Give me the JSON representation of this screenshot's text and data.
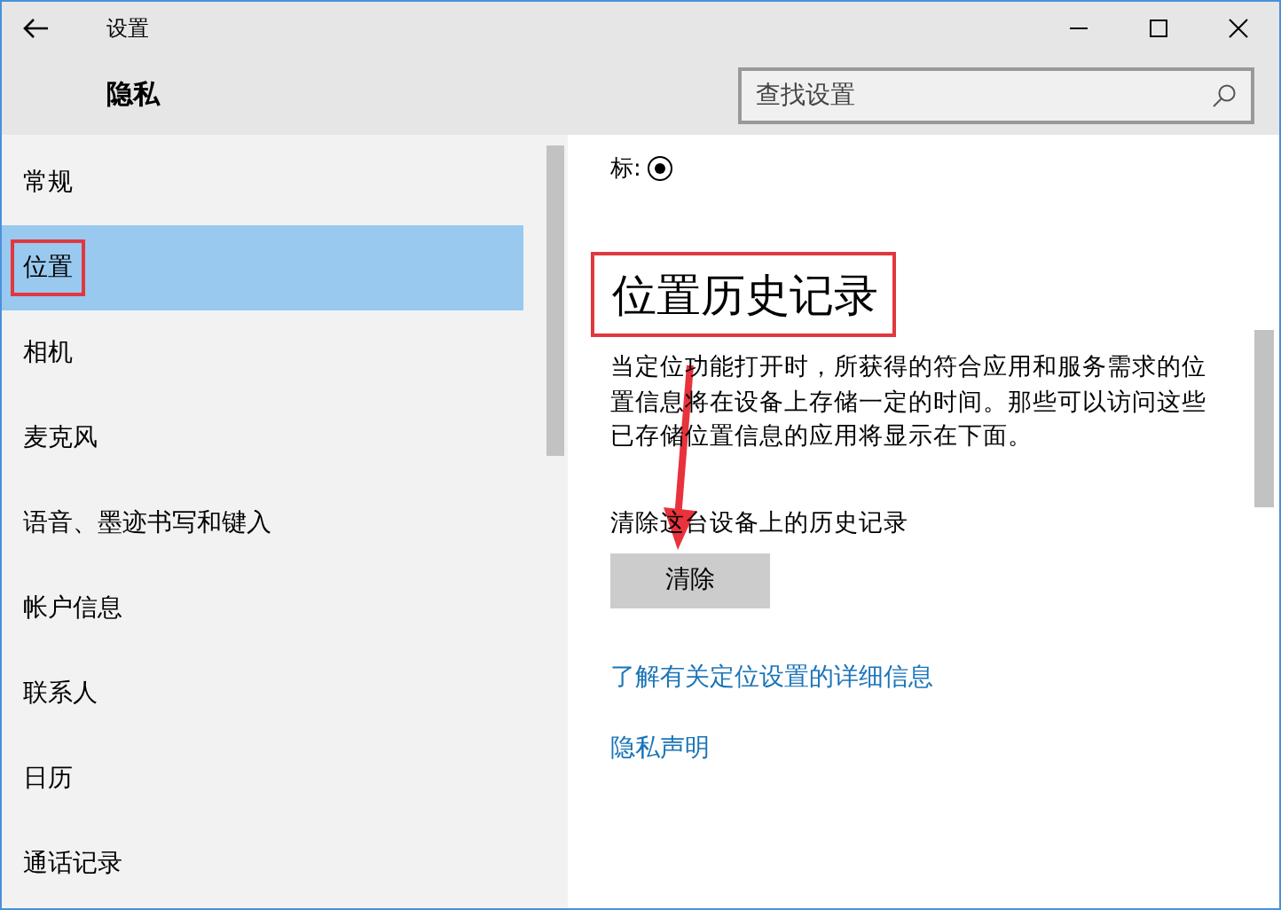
{
  "window": {
    "title": "设置"
  },
  "page_title": "隐私",
  "search": {
    "placeholder": "查找设置"
  },
  "sidebar": {
    "items": [
      {
        "label": "常规",
        "selected": false
      },
      {
        "label": "位置",
        "selected": true
      },
      {
        "label": "相机",
        "selected": false
      },
      {
        "label": "麦克风",
        "selected": false
      },
      {
        "label": "语音、墨迹书写和键入",
        "selected": false
      },
      {
        "label": "帐户信息",
        "selected": false
      },
      {
        "label": "联系人",
        "selected": false
      },
      {
        "label": "日历",
        "selected": false
      },
      {
        "label": "通话记录",
        "selected": false
      }
    ]
  },
  "content": {
    "radio_label": "标:",
    "radio_checked": true,
    "heading": "位置历史记录",
    "description": "当定位功能打开时，所获得的符合应用和服务需求的位置信息将在设备上存储一定的时间。那些可以访问这些已存储位置信息的应用将显示在下面。",
    "clear_label": "清除这台设备上的历史记录",
    "clear_button": "清除",
    "links": [
      "了解有关定位设置的详细信息",
      "隐私声明"
    ]
  }
}
